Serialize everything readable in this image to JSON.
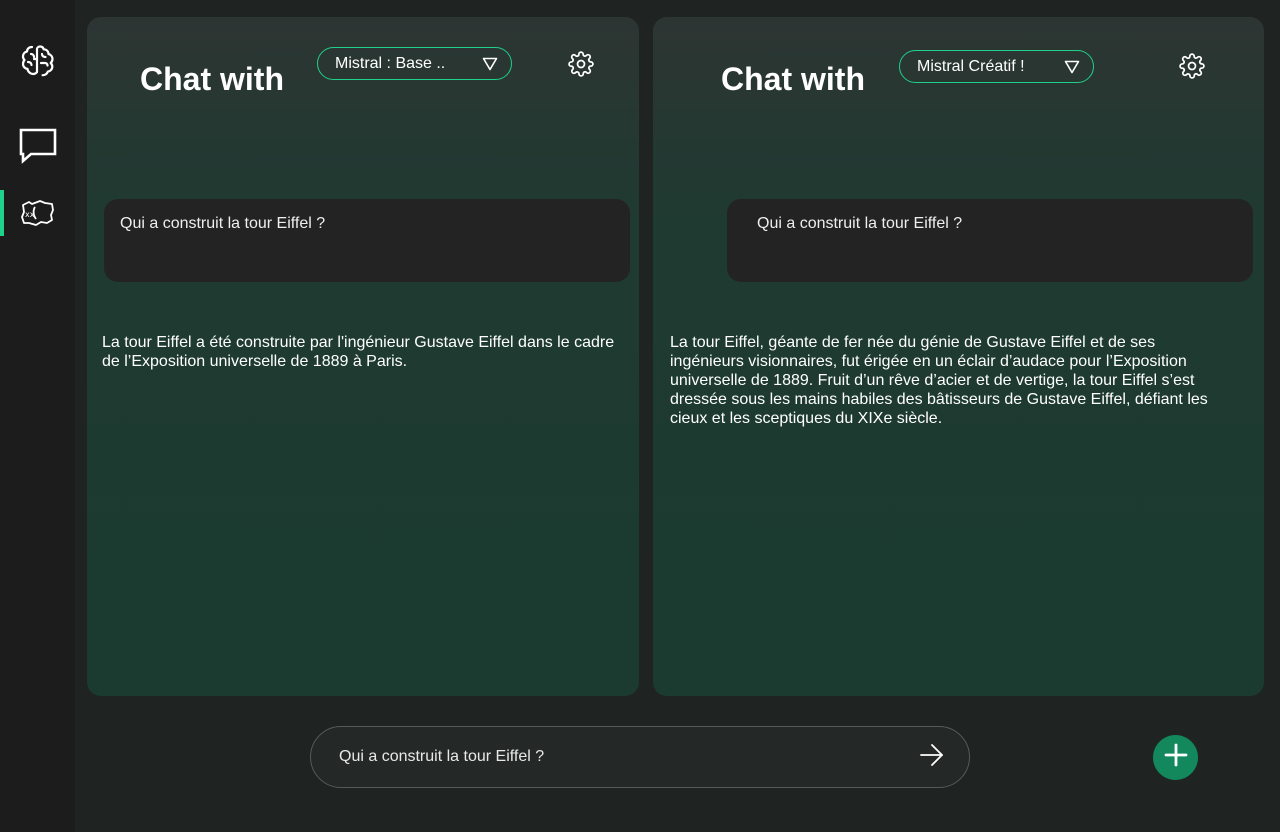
{
  "sidebar": {
    "items": [
      {
        "icon": "brain-icon"
      },
      {
        "icon": "chat-bubble-icon"
      },
      {
        "icon": "map-xx-icon",
        "active": true
      }
    ]
  },
  "panels": [
    {
      "title": "Chat with",
      "model": "Mistral : Base ..",
      "question": "Qui a construit la tour Eiffel ?",
      "answer": "La tour Eiffel a été construite par l'ingénieur Gustave Eiffel dans le cadre de l’Exposition universelle de 1889 à Paris."
    },
    {
      "title": "Chat with",
      "model": "Mistral Créatif !",
      "question": "Qui a construit la tour Eiffel ?",
      "answer": "La tour Eiffel, géante de fer née du génie de Gustave Eiffel et de ses ingénieurs visionnaires, fut érigée en un éclair d’audace pour l’Exposition universelle de 1889. Fruit d’un rêve d’acier et de vertige, la tour Eiffel s’est dressée sous les mains habiles des bâtisseurs de Gustave Eiffel, défiant les cieux et les sceptiques du XIXe siècle."
    }
  ],
  "prompt": {
    "value": "Qui a construit la tour Eiffel ?"
  },
  "colors": {
    "accent": "#1fd18a",
    "add_button": "#12885c",
    "sidebar": "#1c1c1c",
    "bubble": "#232323"
  }
}
